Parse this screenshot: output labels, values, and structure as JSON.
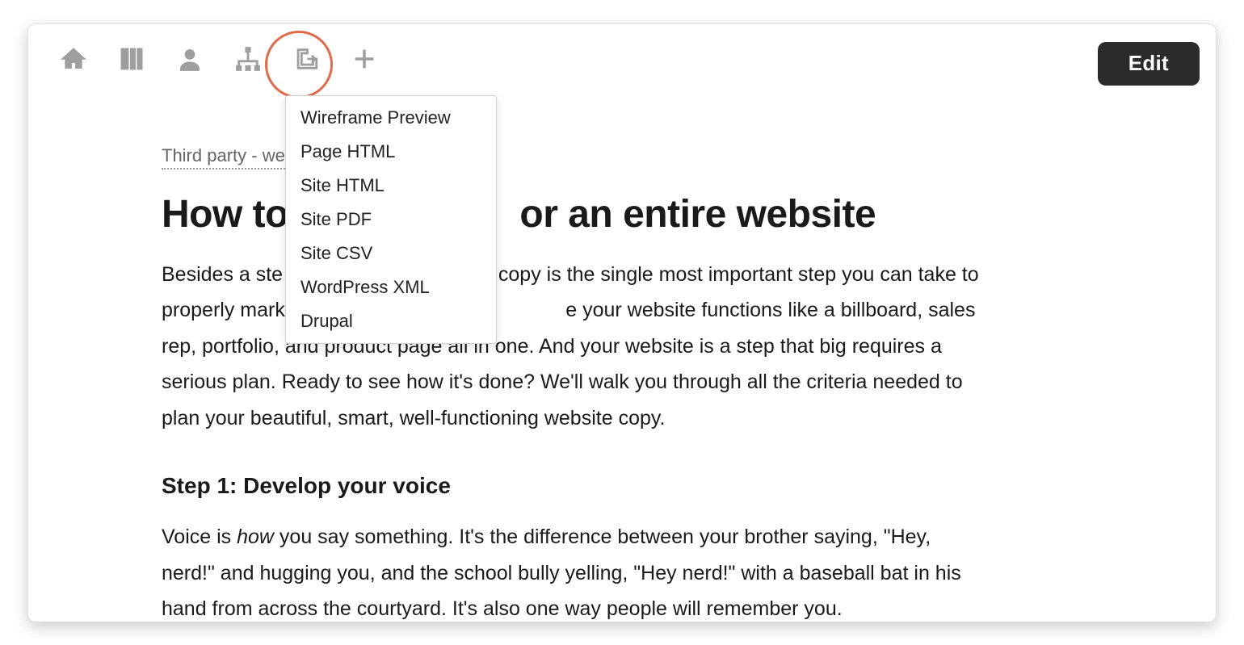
{
  "toolbar": {
    "icons": [
      "home-icon",
      "panel-icon",
      "user-icon",
      "sitemap-icon",
      "export-icon",
      "add-icon"
    ],
    "edit_label": "Edit"
  },
  "export_menu": {
    "items": [
      "Wireframe Preview",
      "Page HTML",
      "Site HTML",
      "Site PDF",
      "Site CSV",
      "WordPress XML",
      "Drupal"
    ]
  },
  "page": {
    "breadcrumb": "Third party - web",
    "title_left": "How to",
    "title_right": "or an entire website",
    "intro_pre": "Besides a ste",
    "intro_mid": "copy is the single most important step you can take to properly market your s",
    "intro_post": "e your website functions like a billboard, sales rep, portfolio, and product page all in one. And your website is a step that big requires a serious plan. Ready to see how it's done? We'll walk you through all the criteria needed to plan your beautiful, smart, well-functioning website copy.",
    "step1_heading": "Step 1: Develop your voice",
    "step1_body_a": "Voice is ",
    "step1_body_em": "how",
    "step1_body_b": " you say something. It's the difference between your brother saying, \"Hey, nerd!\" and hugging you, and the school bully yelling, \"Hey nerd!\" with a baseball bat in his hand from across the courtyard. It's also one way people will remember you."
  }
}
